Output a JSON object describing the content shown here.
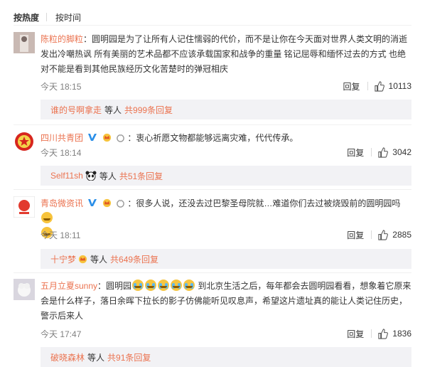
{
  "tabs": {
    "hot": "按热度",
    "time": "按时间"
  },
  "comments": [
    {
      "user": "陈粒的脚粒",
      "text": "：圆明园是为了让所有人记住懦弱的代价，而不是让你在今天面对世界人类文明的消逝发出冷嘲热讽 所有美丽的艺术品都不应该承载国家和战争的重量  铭记屈辱和缅怀过去的方式 也绝对不能是看到其他民族经历文化苦楚时的弹冠相庆",
      "time": "今天 18:15",
      "reply": "回复",
      "likes": "10113",
      "sub": {
        "user": "谁的号啊拿走",
        "mid": "等人",
        "count": "共999条回复"
      }
    },
    {
      "user": "四川共青团",
      "text": "：衷心祈愿文物都能够远离灾难，代代传承。",
      "time": "今天 18:14",
      "reply": "回复",
      "likes": "3042",
      "sub": {
        "user": "Self11sh",
        "mid": "等人",
        "count": "共51条回复"
      }
    },
    {
      "user": "青岛微资讯",
      "text_a": "：很多人说，还没去过巴黎圣母院就…难道你们去过被烧毁前的圆明园吗",
      "time": "今天 18:11",
      "reply": "回复",
      "likes": "2885",
      "sub": {
        "user": "十宁梦",
        "mid": "等人",
        "count": "共649条回复"
      }
    },
    {
      "user": "五月立夏sunny",
      "text_a": "：圆明园",
      "text_b": " 到北京生活之后，每年都会去圆明园看看，想象着它原来会是什么样子，落日余晖下拉长的影子仿佛能听见叹息声，希望这片遗址真的能让人类记住历史，警示后来人",
      "time": "今天 17:47",
      "reply": "回复",
      "likes": "1836",
      "sub": {
        "user": "破晓森林",
        "mid": "等人",
        "count": "共91条回复"
      }
    }
  ],
  "colors": {
    "name": "#eb7350",
    "sub_bg": "#f2f2f5",
    "time": "#808080"
  }
}
